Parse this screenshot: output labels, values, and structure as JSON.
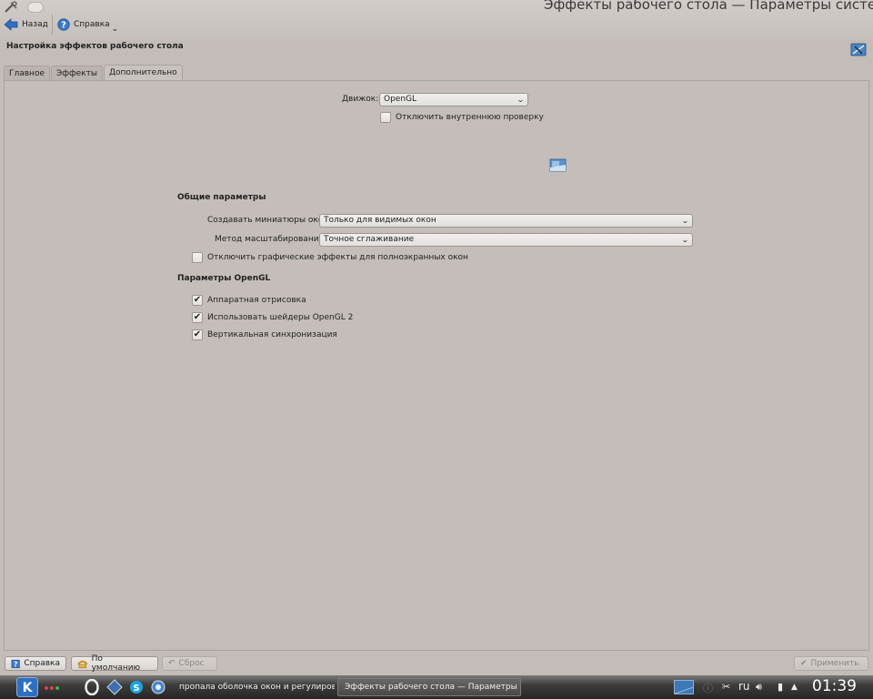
{
  "window": {
    "title": "Эффекты рабочего стола — Параметры системы"
  },
  "toolbar": {
    "back_label": "Назад",
    "help_label": "Справка",
    "help_dropdown_glyph": "⌄"
  },
  "module": {
    "title": "Настройка эффектов рабочего стола"
  },
  "tabs": [
    {
      "label": "Главное",
      "active": false
    },
    {
      "label": "Эффекты",
      "active": false
    },
    {
      "label": "Дополнительно",
      "active": true
    }
  ],
  "engine": {
    "label": "Движок:",
    "value": "OpenGL",
    "disable_check_label": "Отключить внутреннюю проверку",
    "disable_check_checked": false
  },
  "general": {
    "title": "Общие параметры",
    "thumbnails_label": "Создавать миниатюры окон",
    "thumbnails_value": "Только для видимых окон",
    "scaling_label": "Метод масштабирования:",
    "scaling_value": "Точное сглаживание",
    "fullscreen_label": "Отключить графические эффекты для полноэкранных окон",
    "fullscreen_checked": false
  },
  "opengl": {
    "title": "Параметры OpenGL",
    "options": [
      {
        "label": "Аппаратная отрисовка",
        "checked": true
      },
      {
        "label": "Использовать шейдеры OpenGL 2",
        "checked": true
      },
      {
        "label": "Вертикальная синхронизация",
        "checked": true
      }
    ]
  },
  "bottom": {
    "help_label": "Справка",
    "defaults_label": "По умолчанию",
    "reset_label": "Сброс",
    "apply_label": "Применить"
  },
  "taskbar": {
    "tasks": [
      {
        "label": "пропала оболочка окон и регулировка"
      },
      {
        "label": "Эффекты рабочего стола — Параметры"
      }
    ],
    "keyboard_layout": "ru",
    "clock": "01:39"
  },
  "colors": {
    "background": "#c3bcb8",
    "taskbar": "#262626",
    "check_mark": "#222222"
  }
}
